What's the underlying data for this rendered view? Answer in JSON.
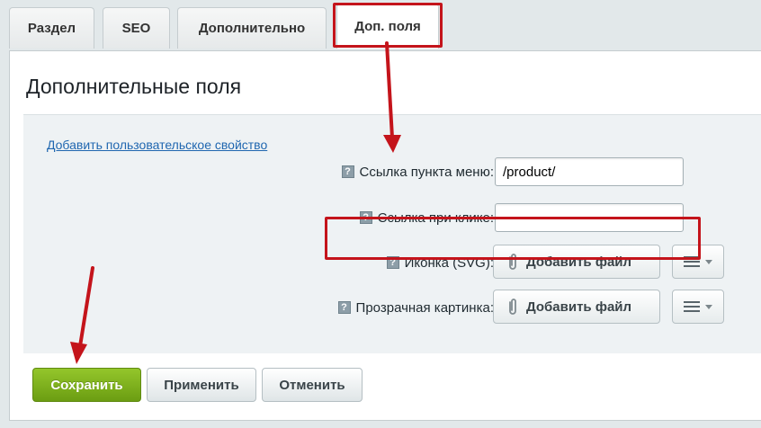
{
  "tabs": [
    {
      "label": "Раздел",
      "active": false
    },
    {
      "label": "SEO",
      "active": false
    },
    {
      "label": "Дополнительно",
      "active": false
    },
    {
      "label": "Доп. поля",
      "active": true
    }
  ],
  "panel": {
    "title": "Дополнительные поля",
    "add_property_link": "Добавить пользовательское свойство"
  },
  "fields": {
    "menu_link": {
      "label": "Ссылка пункта меню:",
      "value": "/product/",
      "help_icon": "question-icon"
    },
    "click_link": {
      "label": "Ссылка при клике:",
      "value": "",
      "help_icon": "question-icon"
    },
    "svg_icon": {
      "label": "Иконка (SVG):",
      "button_label": "Добавить файл",
      "icon": "paperclip-icon",
      "help_icon": "question-icon"
    },
    "transparent_image": {
      "label": "Прозрачная картинка:",
      "button_label": "Добавить файл",
      "icon": "paperclip-icon",
      "help_icon": "question-icon"
    }
  },
  "buttons": {
    "save": "Сохранить",
    "apply": "Применить",
    "cancel": "Отменить"
  },
  "colors": {
    "save_button": "#7fb11d",
    "annotation": "#c4141b",
    "link": "#2067b0"
  }
}
